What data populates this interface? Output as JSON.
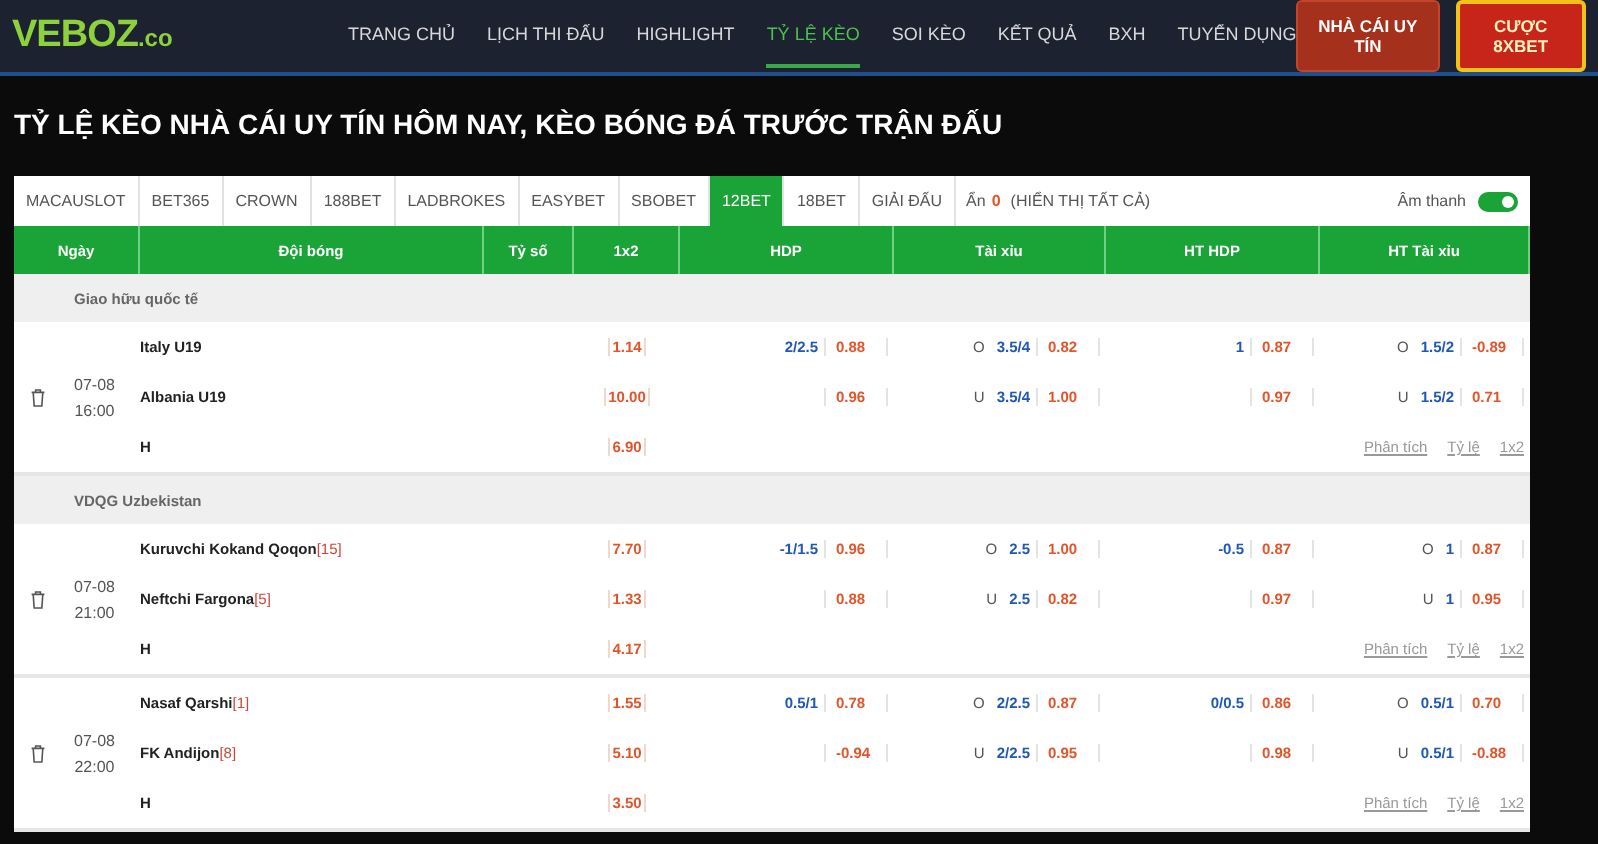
{
  "logo": {
    "name": "VEBOZ",
    "suffix": ".co"
  },
  "nav": [
    {
      "label": "TRANG CHỦ",
      "selected": false
    },
    {
      "label": "LỊCH THI ĐẤU",
      "selected": false
    },
    {
      "label": "HIGHLIGHT",
      "selected": false
    },
    {
      "label": "TỶ LỆ KÈO",
      "selected": true
    },
    {
      "label": "SOI KÈO",
      "selected": false
    },
    {
      "label": "KẾT QUẢ",
      "selected": false
    },
    {
      "label": "BXH",
      "selected": false
    },
    {
      "label": "TUYỂN DỤNG",
      "selected": false
    }
  ],
  "header_buttons": [
    {
      "label": "NHÀ CÁI UY TÍN",
      "kind": "plain"
    },
    {
      "label": "CƯỢC 8XBET",
      "kind": "promo"
    }
  ],
  "page_title": "TỶ LỆ KÈO NHÀ CÁI UY TÍN HÔM NAY, KÈO BÓNG ĐÁ TRƯỚC TRẬN ĐẤU",
  "bookmakers": [
    {
      "label": "MACAUSLOT",
      "selected": false
    },
    {
      "label": "BET365",
      "selected": false
    },
    {
      "label": "CROWN",
      "selected": false
    },
    {
      "label": "188BET",
      "selected": false
    },
    {
      "label": "LADBROKES",
      "selected": false
    },
    {
      "label": "EASYBET",
      "selected": false
    },
    {
      "label": "SBOBET",
      "selected": false
    },
    {
      "label": "12BET",
      "selected": true
    },
    {
      "label": "18BET",
      "selected": false
    },
    {
      "label": "GIẢI ĐẤU",
      "selected": false
    }
  ],
  "hidden": {
    "label": "Ẩn",
    "count": "0",
    "show_all": "(HIỂN THỊ TẤT CẢ)"
  },
  "sound": {
    "label": "Âm thanh",
    "on": true
  },
  "columns": [
    "Ngày",
    "Đội bóng",
    "Tỷ số",
    "1x2",
    "HDP",
    "Tài xỉu",
    "HT HDP",
    "HT Tài xỉu"
  ],
  "groups": [
    {
      "name": "Giao hữu quốc tế",
      "matches": [
        {
          "date": "07-08",
          "time": "16:00",
          "home": "Italy U19",
          "away": "Albania U19",
          "draw": "H",
          "x12": [
            "1.14",
            "10.00",
            "6.90"
          ],
          "hdp": [
            {
              "line": "2/2.5",
              "odds": "0.88"
            },
            {
              "odds": "0.96"
            }
          ],
          "ou": [
            {
              "side": "O",
              "line": "3.5/4",
              "odds": "0.82"
            },
            {
              "side": "U",
              "line": "3.5/4",
              "odds": "1.00"
            }
          ],
          "ht_hdp": [
            {
              "line": "1",
              "odds": "0.87"
            },
            {
              "odds": "0.97"
            }
          ],
          "ht_ou": [
            {
              "side": "O",
              "line": "1.5/2",
              "odds": "-0.89"
            },
            {
              "side": "U",
              "line": "1.5/2",
              "odds": "0.71"
            }
          ],
          "links": [
            "Phân tích",
            "Tỷ lệ",
            "1x2"
          ]
        }
      ]
    },
    {
      "name": "VDQG Uzbekistan",
      "matches": [
        {
          "date": "07-08",
          "time": "21:00",
          "home": "Kuruvchi Kokand Qoqon",
          "home_rank": "[15]",
          "away": "Neftchi Fargona",
          "away_rank": "[5]",
          "draw": "H",
          "x12": [
            "7.70",
            "1.33",
            "4.17"
          ],
          "hdp": [
            {
              "line": "-1/1.5",
              "odds": "0.96"
            },
            {
              "odds": "0.88"
            }
          ],
          "ou": [
            {
              "side": "O",
              "line": "2.5",
              "odds": "1.00"
            },
            {
              "side": "U",
              "line": "2.5",
              "odds": "0.82"
            }
          ],
          "ht_hdp": [
            {
              "line": "-0.5",
              "odds": "0.87"
            },
            {
              "odds": "0.97"
            }
          ],
          "ht_ou": [
            {
              "side": "O",
              "line": "1",
              "odds": "0.87"
            },
            {
              "side": "U",
              "line": "1",
              "odds": "0.95"
            }
          ],
          "links": [
            "Phân tích",
            "Tỷ lệ",
            "1x2"
          ]
        },
        {
          "date": "07-08",
          "time": "22:00",
          "home": "Nasaf Qarshi",
          "home_rank": "[1]",
          "away": "FK Andijon",
          "away_rank": "[8]",
          "draw": "H",
          "x12": [
            "1.55",
            "5.10",
            "3.50"
          ],
          "hdp": [
            {
              "line": "0.5/1",
              "odds": "0.78"
            },
            {
              "odds": "-0.94"
            }
          ],
          "ou": [
            {
              "side": "O",
              "line": "2/2.5",
              "odds": "0.87"
            },
            {
              "side": "U",
              "line": "2/2.5",
              "odds": "0.95"
            }
          ],
          "ht_hdp": [
            {
              "line": "0/0.5",
              "odds": "0.86"
            },
            {
              "odds": "0.98"
            }
          ],
          "ht_ou": [
            {
              "side": "O",
              "line": "0.5/1",
              "odds": "0.70"
            },
            {
              "side": "U",
              "line": "0.5/1",
              "odds": "-0.88"
            }
          ],
          "links": [
            "Phân tích",
            "Tỷ lệ",
            "1x2"
          ]
        }
      ]
    }
  ]
}
